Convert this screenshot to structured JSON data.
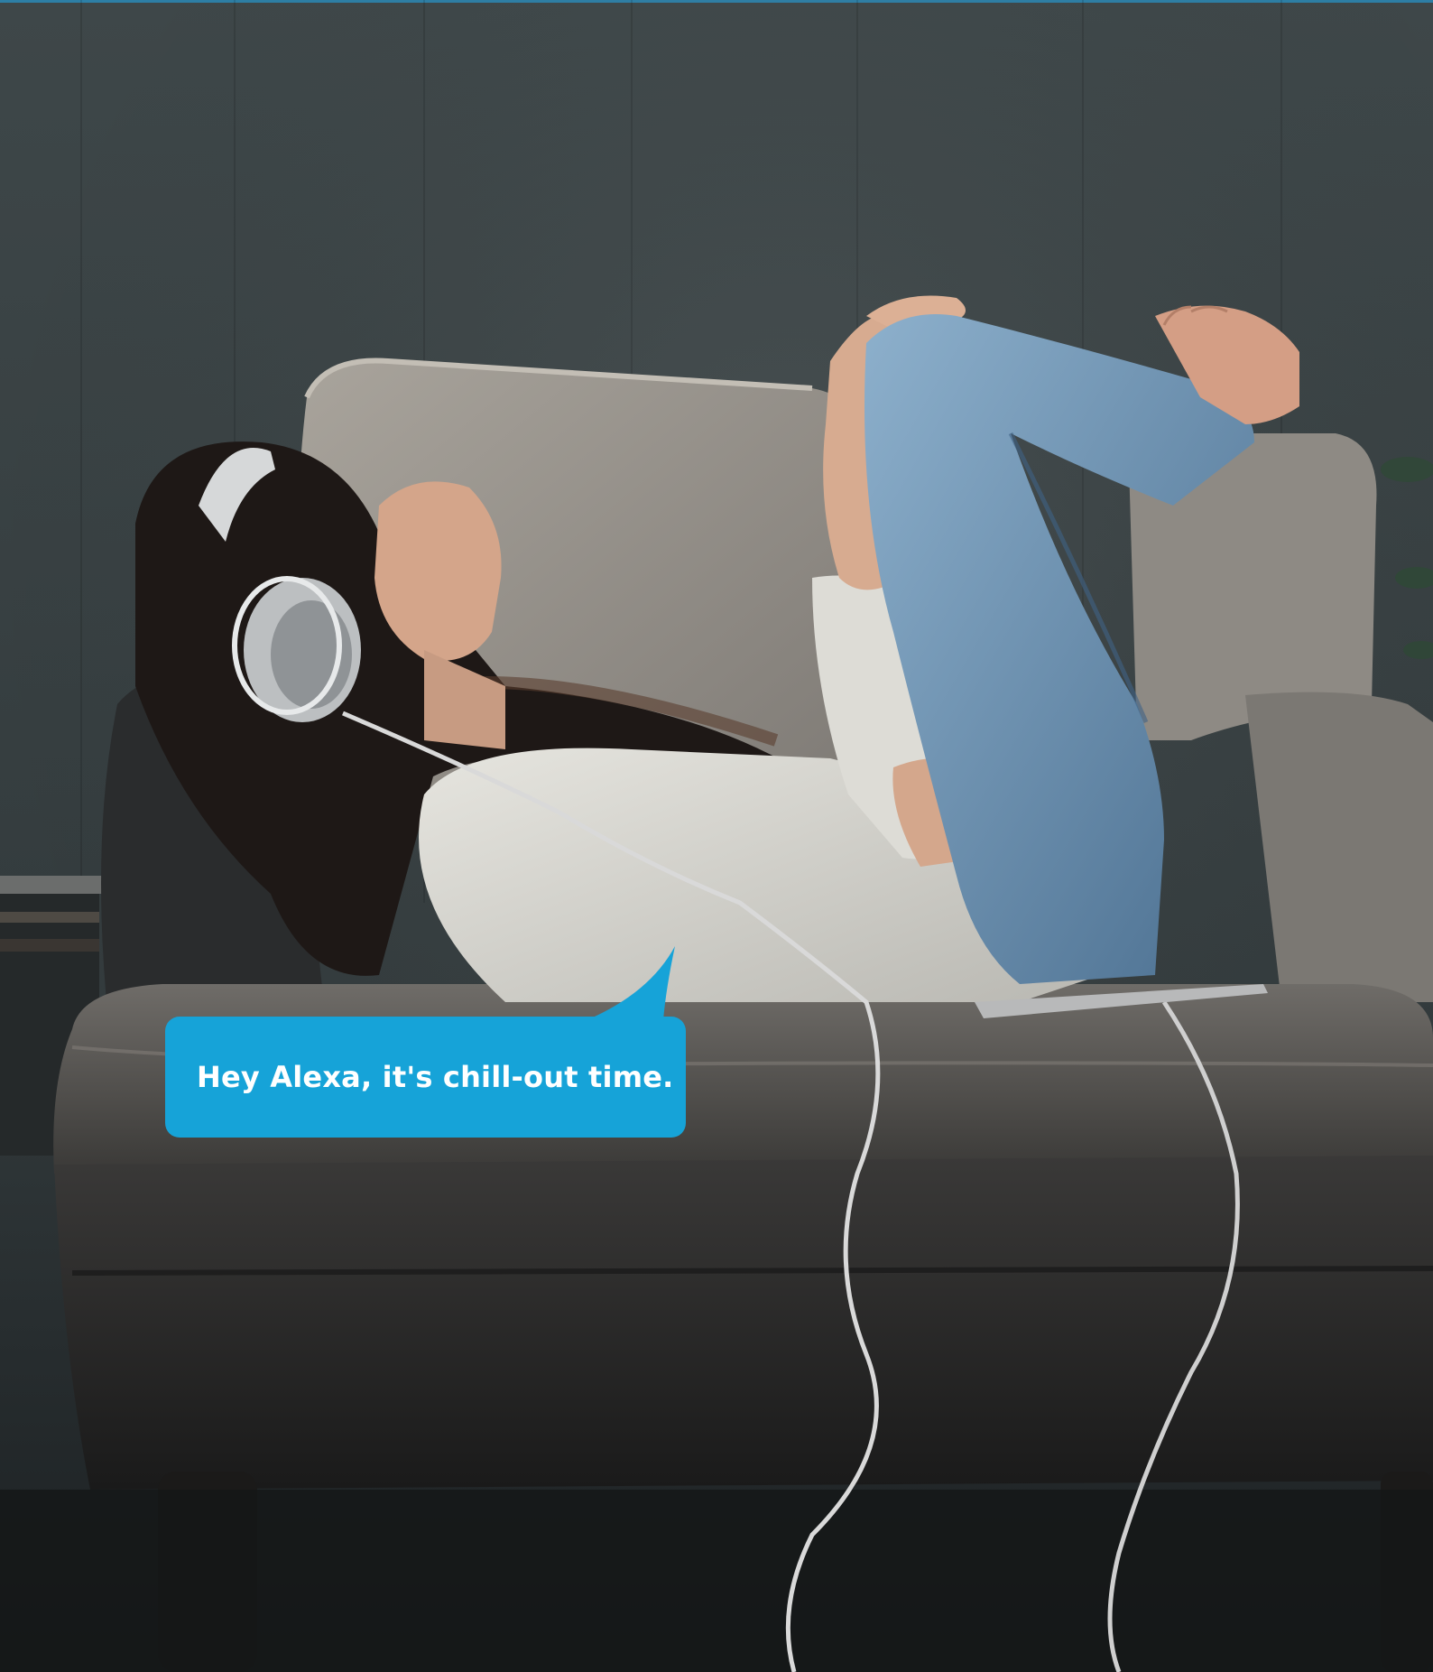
{
  "photo": {
    "description_icon": "woman-on-sofa-with-headphones"
  },
  "speech_bubble": {
    "text": "Hey Alexa, it's chill-out time.",
    "color": "#16a3d8"
  },
  "colors": {
    "background_wall": "#3b4446",
    "sofa": "#8a8782",
    "jeans": "#6d93b4",
    "sweater": "#d9d8d2"
  }
}
